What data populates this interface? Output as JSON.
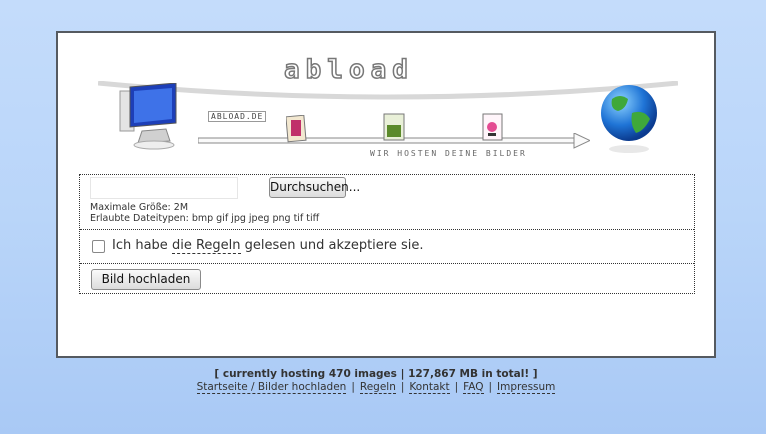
{
  "banner": {
    "logo": "abload",
    "site_label": "ABLOAD.DE",
    "tagline": "WIR HOSTEN DEINE BILDER"
  },
  "upload_form": {
    "browse_button": "Durchsuchen...",
    "max_size": "Maximale Größe: 2M",
    "allowed_types": "Erlaubte Dateitypen: bmp gif jpg jpeg png tif tiff",
    "accept_before": "Ich habe ",
    "accept_link": "die Regeln",
    "accept_after": " gelesen und akzeptiere sie.",
    "accept_checked": false,
    "upload_button": "Bild hochladen"
  },
  "footer": {
    "stats": "[ currently hosting 470 images | 127,867 MB in total! ]",
    "links": [
      "Startseite / Bilder hochladen",
      "Regeln",
      "Kontakt",
      "FAQ",
      "Impressum"
    ]
  },
  "colors": {
    "background_top": "#c4dcfb",
    "background_bottom": "#a9c9f5",
    "panel_border": "#555a60"
  }
}
